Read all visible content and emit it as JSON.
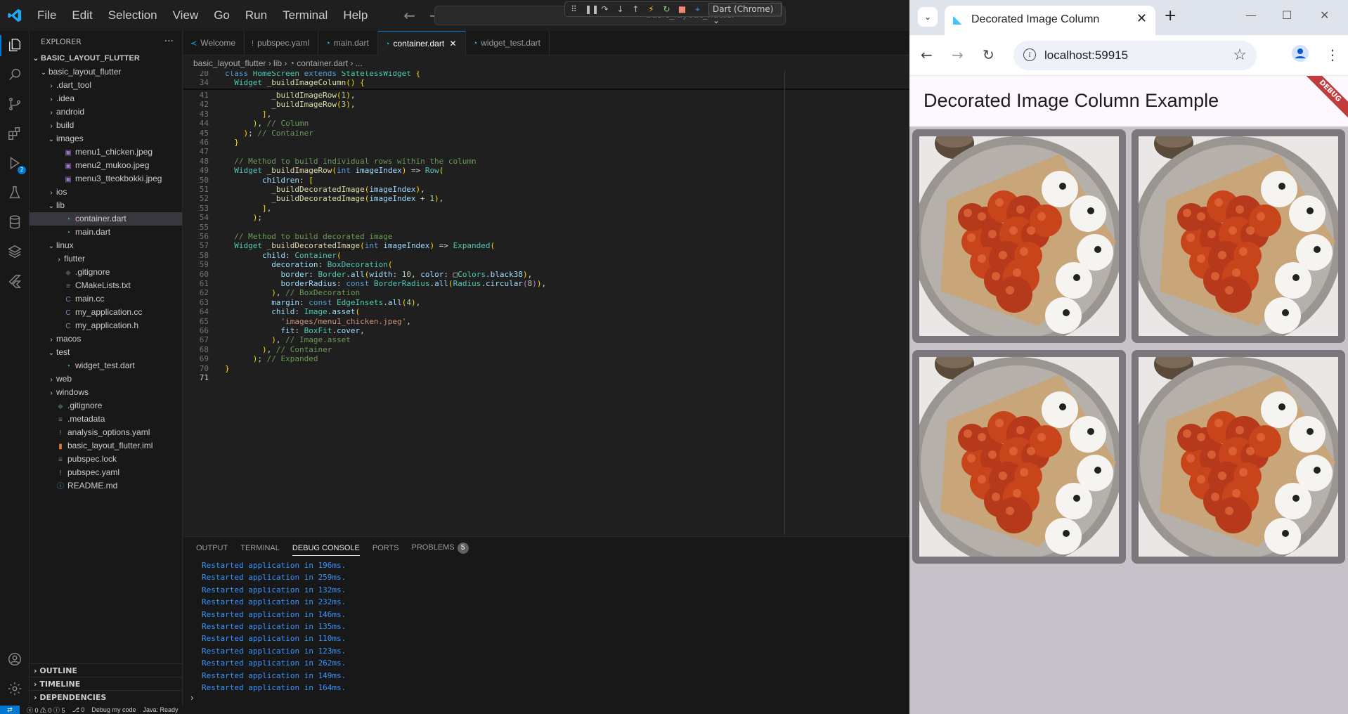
{
  "vscode": {
    "menu": [
      "File",
      "Edit",
      "Selection",
      "View",
      "Go",
      "Run",
      "Terminal",
      "Help"
    ],
    "command_center": "basic_layout_flutter",
    "debug_target": "Dart (Chrome)",
    "explorer_title": "EXPLORER",
    "tree": [
      {
        "label": "BASIC_LAYOUT_FLUTTER",
        "depth": 0,
        "type": "root",
        "open": true
      },
      {
        "label": "basic_layout_flutter",
        "depth": 1,
        "type": "folder",
        "open": true
      },
      {
        "label": ".dart_tool",
        "depth": 2,
        "type": "folder",
        "open": false
      },
      {
        "label": ".idea",
        "depth": 2,
        "type": "folder",
        "open": false
      },
      {
        "label": "android",
        "depth": 2,
        "type": "folder",
        "open": false
      },
      {
        "label": "build",
        "depth": 2,
        "type": "folder",
        "open": false
      },
      {
        "label": "images",
        "depth": 2,
        "type": "folder",
        "open": true
      },
      {
        "label": "menu1_chicken.jpeg",
        "depth": 3,
        "type": "image"
      },
      {
        "label": "menu2_mukoo.jpeg",
        "depth": 3,
        "type": "image"
      },
      {
        "label": "menu3_tteokbokki.jpeg",
        "depth": 3,
        "type": "image"
      },
      {
        "label": "ios",
        "depth": 2,
        "type": "folder",
        "open": false
      },
      {
        "label": "lib",
        "depth": 2,
        "type": "folder",
        "open": true
      },
      {
        "label": "container.dart",
        "depth": 3,
        "type": "dart",
        "selected": true
      },
      {
        "label": "main.dart",
        "depth": 3,
        "type": "dart"
      },
      {
        "label": "linux",
        "depth": 2,
        "type": "folder",
        "open": true
      },
      {
        "label": "flutter",
        "depth": 3,
        "type": "folder",
        "open": false
      },
      {
        "label": ".gitignore",
        "depth": 3,
        "type": "git"
      },
      {
        "label": "CMakeLists.txt",
        "depth": 3,
        "type": "txt"
      },
      {
        "label": "main.cc",
        "depth": 3,
        "type": "c"
      },
      {
        "label": "my_application.cc",
        "depth": 3,
        "type": "c"
      },
      {
        "label": "my_application.h",
        "depth": 3,
        "type": "c"
      },
      {
        "label": "macos",
        "depth": 2,
        "type": "folder",
        "open": false
      },
      {
        "label": "test",
        "depth": 2,
        "type": "folder",
        "open": true
      },
      {
        "label": "widget_test.dart",
        "depth": 3,
        "type": "dart"
      },
      {
        "label": "web",
        "depth": 2,
        "type": "folder",
        "open": false
      },
      {
        "label": "windows",
        "depth": 2,
        "type": "folder",
        "open": false
      },
      {
        "label": ".gitignore",
        "depth": 2,
        "type": "git"
      },
      {
        "label": ".metadata",
        "depth": 2,
        "type": "meta"
      },
      {
        "label": "analysis_options.yaml",
        "depth": 2,
        "type": "yaml"
      },
      {
        "label": "basic_layout_flutter.iml",
        "depth": 2,
        "type": "iml"
      },
      {
        "label": "pubspec.lock",
        "depth": 2,
        "type": "lock"
      },
      {
        "label": "pubspec.yaml",
        "depth": 2,
        "type": "yaml"
      },
      {
        "label": "README.md",
        "depth": 2,
        "type": "md"
      }
    ],
    "sidebar_footer": [
      "OUTLINE",
      "TIMELINE",
      "DEPENDENCIES"
    ],
    "tabs": [
      {
        "label": "Welcome",
        "icon": "vscode-icon",
        "active": false
      },
      {
        "label": "pubspec.yaml",
        "icon": "exclaim-icon",
        "active": false
      },
      {
        "label": "main.dart",
        "icon": "dart-icon",
        "active": false
      },
      {
        "label": "container.dart",
        "icon": "dart-icon",
        "active": true
      },
      {
        "label": "widget_test.dart",
        "icon": "dart-icon",
        "active": false
      }
    ],
    "breadcrumb": "basic_layout_flutter  ›  lib  ›  ◔ container.dart  ›  ...",
    "sticky_lines": [
      {
        "n": "20",
        "code": "class HomeScreen extends StatelessWidget {"
      },
      {
        "n": "34",
        "code": "  Widget _buildImageColumn() {"
      }
    ],
    "code_lines": [
      {
        "n": "41",
        "code": "          _buildImageRow(1),"
      },
      {
        "n": "42",
        "code": "          _buildImageRow(3),"
      },
      {
        "n": "43",
        "code": "        ],"
      },
      {
        "n": "44",
        "code": "      ), // Column"
      },
      {
        "n": "45",
        "code": "    ); // Container"
      },
      {
        "n": "46",
        "code": "  }"
      },
      {
        "n": "47",
        "code": ""
      },
      {
        "n": "48",
        "code": "  // Method to build individual rows within the column"
      },
      {
        "n": "49",
        "code": "  Widget _buildImageRow(int imageIndex) => Row("
      },
      {
        "n": "50",
        "code": "        children: ["
      },
      {
        "n": "51",
        "code": "          _buildDecoratedImage(imageIndex),"
      },
      {
        "n": "52",
        "code": "          _buildDecoratedImage(imageIndex + 1),"
      },
      {
        "n": "53",
        "code": "        ],"
      },
      {
        "n": "54",
        "code": "      );"
      },
      {
        "n": "55",
        "code": ""
      },
      {
        "n": "56",
        "code": "  // Method to build decorated image"
      },
      {
        "n": "57",
        "code": "  Widget _buildDecoratedImage(int imageIndex) => Expanded("
      },
      {
        "n": "58",
        "code": "        child: Container("
      },
      {
        "n": "59",
        "code": "          decoration: BoxDecoration("
      },
      {
        "n": "60",
        "code": "            border: Border.all(width: 10, color: □Colors.black38),"
      },
      {
        "n": "61",
        "code": "            borderRadius: const BorderRadius.all(Radius.circular(8)),"
      },
      {
        "n": "62",
        "code": "          ), // BoxDecoration"
      },
      {
        "n": "63",
        "code": "          margin: const EdgeInsets.all(4),"
      },
      {
        "n": "64",
        "code": "          child: Image.asset("
      },
      {
        "n": "65",
        "code": "            'images/menu1_chicken.jpeg',"
      },
      {
        "n": "66",
        "code": "            fit: BoxFit.cover,"
      },
      {
        "n": "67",
        "code": "          ), // Image.asset"
      },
      {
        "n": "68",
        "code": "        ), // Container"
      },
      {
        "n": "69",
        "code": "      ); // Expanded"
      },
      {
        "n": "70",
        "code": "}"
      },
      {
        "n": "71",
        "code": ""
      }
    ],
    "panel_tabs": [
      "OUTPUT",
      "TERMINAL",
      "DEBUG CONSOLE",
      "PORTS",
      "PROBLEMS"
    ],
    "problems_count": "5",
    "console_lines": [
      "Restarted application in 196ms.",
      "Restarted application in 259ms.",
      "Restarted application in 132ms.",
      "Restarted application in 232ms.",
      "Restarted application in 146ms.",
      "Restarted application in 135ms.",
      "Restarted application in 110ms.",
      "Restarted application in 123ms.",
      "Restarted application in 262ms.",
      "Restarted application in 149ms.",
      "Restarted application in 164ms."
    ],
    "status": {
      "problems": "ⓧ 0 ⚠ 0 ⓘ 5",
      "ports": "⎇ 0",
      "debug": "Debug my code",
      "java": "Java: Ready"
    }
  },
  "browser": {
    "tab_title": "Decorated Image Column",
    "url": "localhost:59915",
    "app_title": "Decorated Image Column Example",
    "debug_banner": "DEBUG",
    "image_count": 4
  },
  "colors": {
    "vscode_accent": "#0078d4",
    "app_bar": "#fdf7ff",
    "body": "#c7c2ca",
    "image_border": "#7a767c"
  }
}
